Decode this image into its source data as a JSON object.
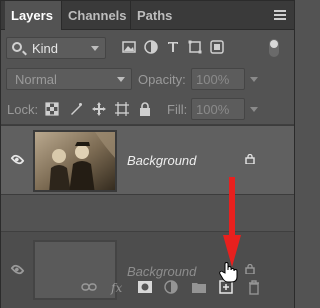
{
  "tabs": [
    {
      "label": "Layers",
      "active": true
    },
    {
      "label": "Channels",
      "active": false
    },
    {
      "label": "Paths",
      "active": false
    }
  ],
  "filter": {
    "kind_label": "Kind"
  },
  "blend": {
    "mode": "Normal",
    "opacity_label": "Opacity:",
    "opacity_value": "100%"
  },
  "lock": {
    "label": "Lock:",
    "fill_label": "Fill:",
    "fill_value": "100%"
  },
  "layers": [
    {
      "name": "Background",
      "visible": true,
      "locked": true,
      "thumbnail": "photo"
    },
    {
      "name": "Background",
      "visible": true,
      "locked": true,
      "thumbnail": "empty"
    }
  ],
  "bottom_icons": [
    "link-layers-icon",
    "fx-icon",
    "layer-mask-icon",
    "adjustment-layer-icon",
    "group-folder-icon",
    "new-layer-icon",
    "trash-icon"
  ],
  "colors": {
    "panel": "#535353",
    "tabbar": "#3a3a3a",
    "selected_row": "#606060",
    "arrow": "#e8201e"
  }
}
